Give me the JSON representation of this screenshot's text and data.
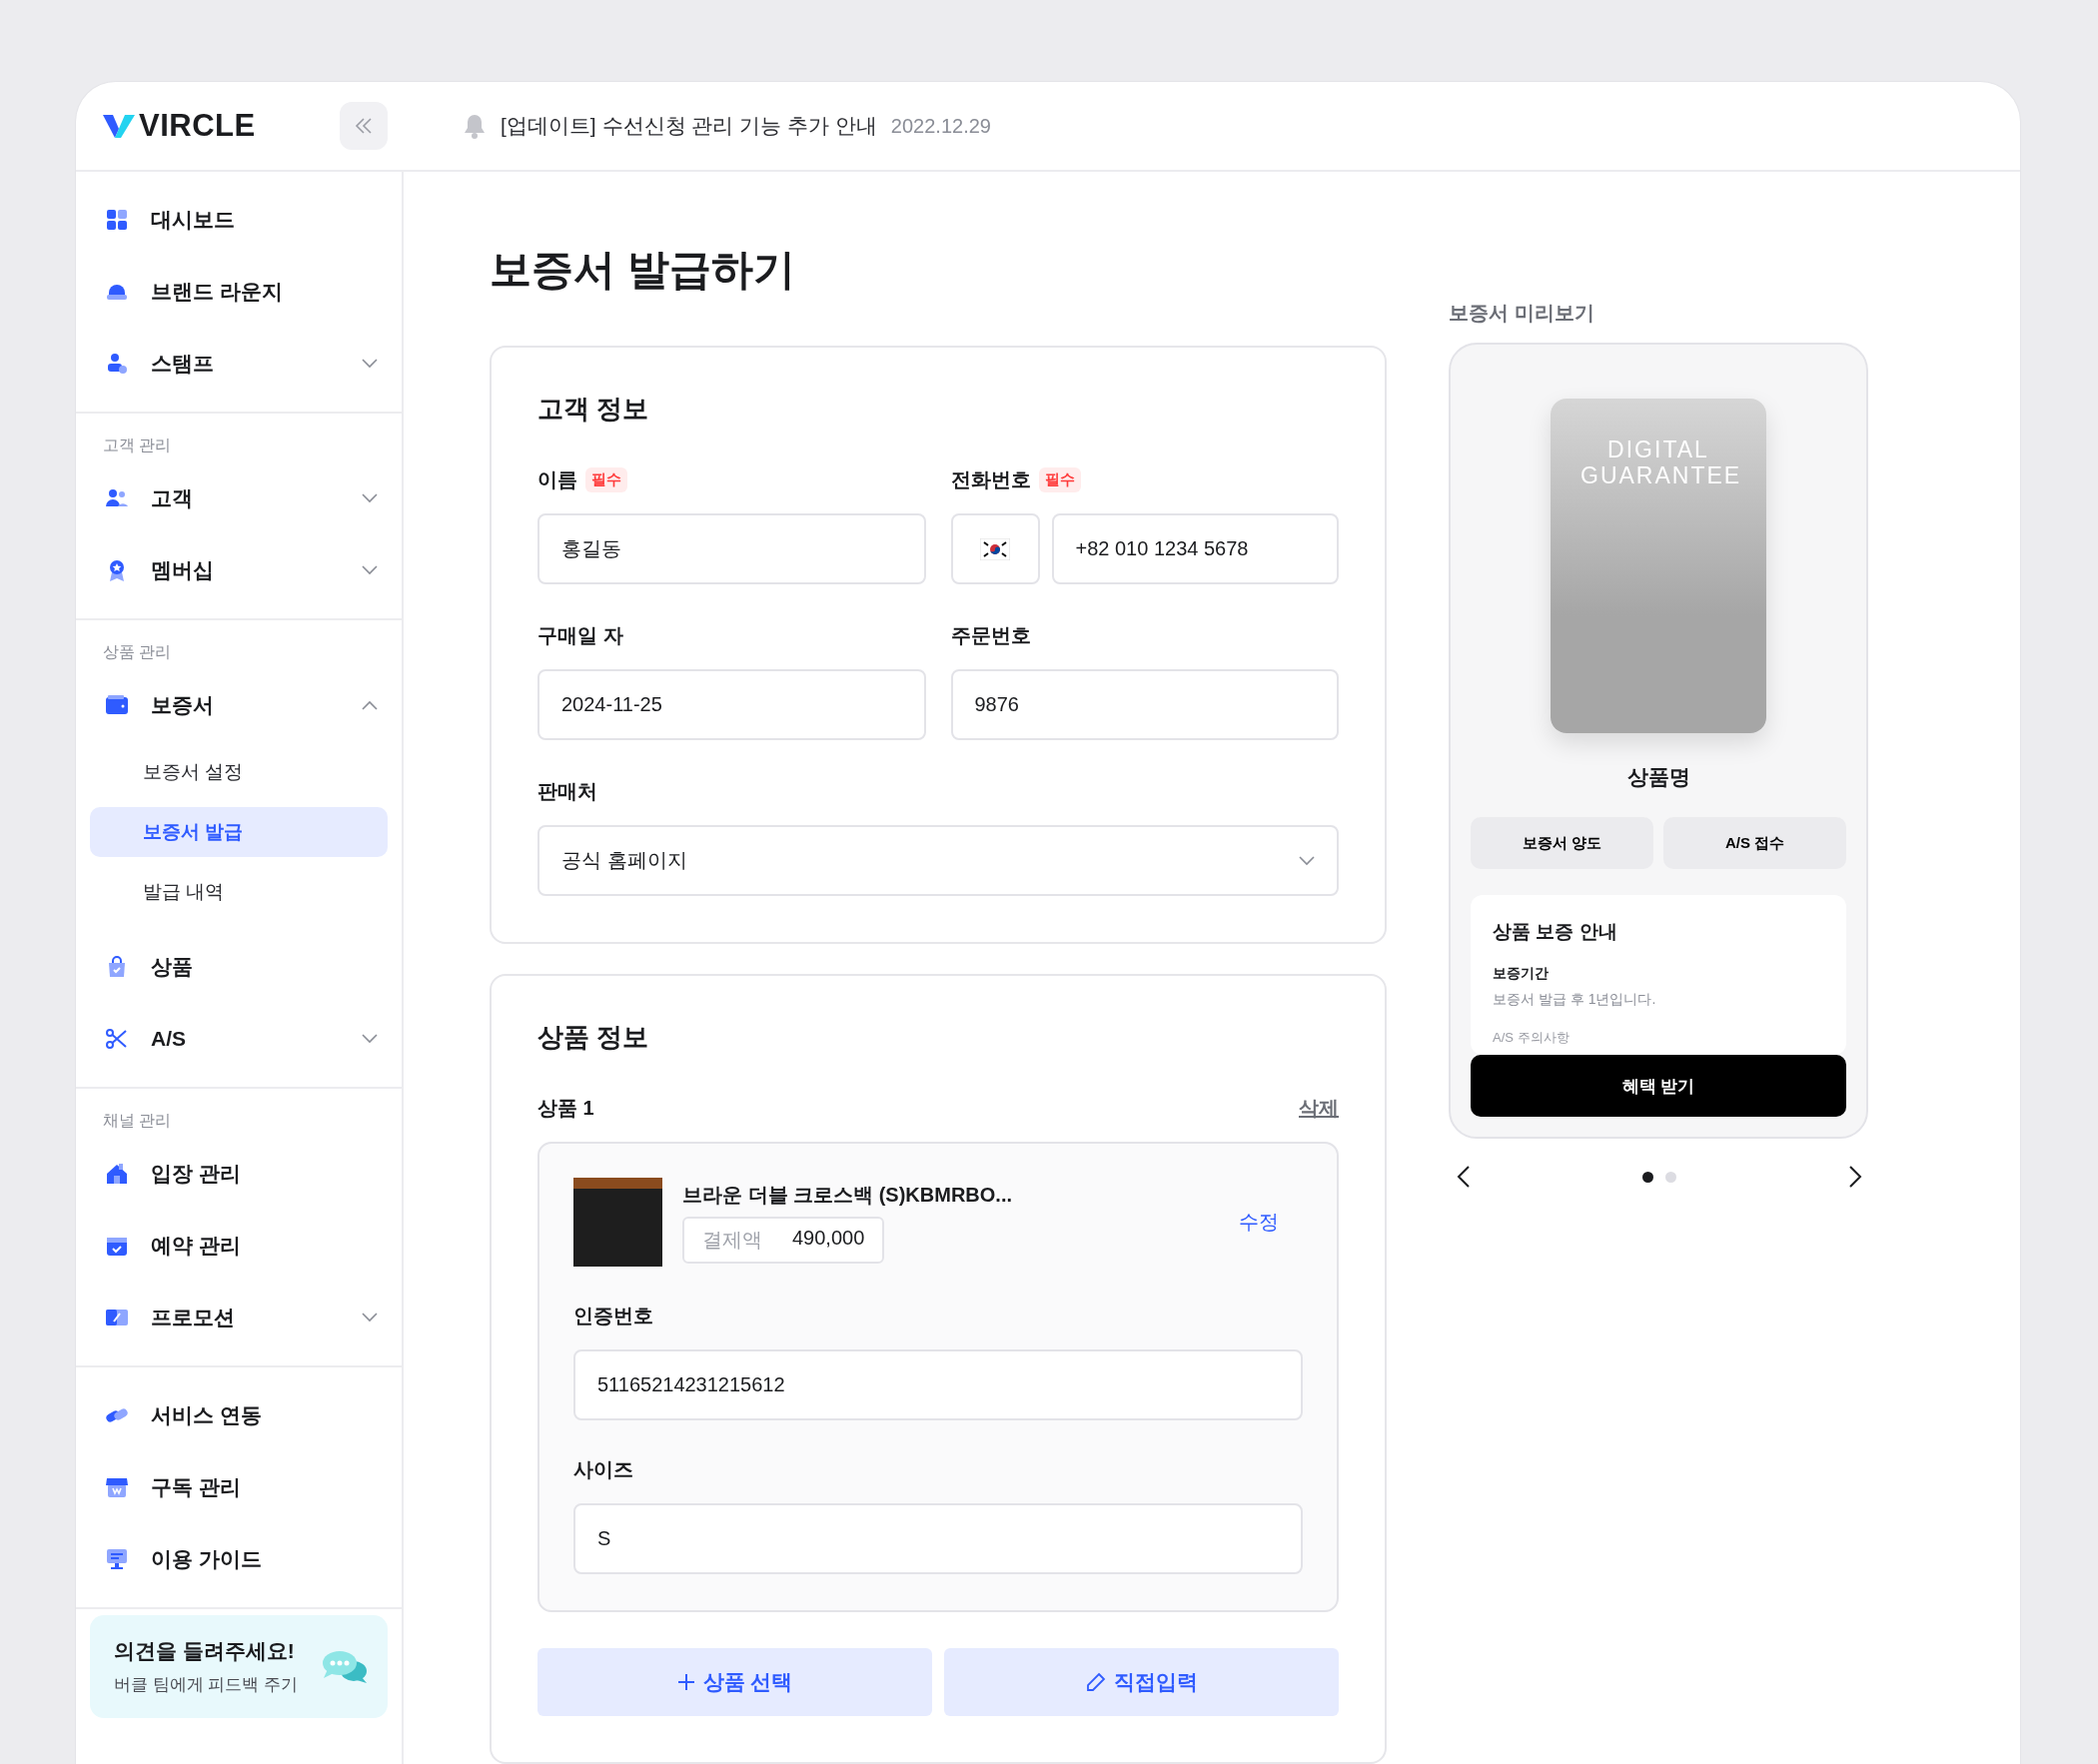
{
  "header": {
    "logo": "VIRCLE",
    "notice": "[업데이트] 수선신청 관리 기능 추가 안내",
    "notice_date": "2022.12.29"
  },
  "sidebar": {
    "sections": [
      {
        "items": [
          {
            "label": "대시보드"
          },
          {
            "label": "브랜드 라운지"
          },
          {
            "label": "스탬프",
            "expanded": false
          }
        ]
      },
      {
        "heading": "고객 관리",
        "items": [
          {
            "label": "고객",
            "expanded": false
          },
          {
            "label": "멤버십",
            "expanded": false
          }
        ]
      },
      {
        "heading": "상품 관리",
        "items": [
          {
            "label": "보증서",
            "expanded": true,
            "children": [
              {
                "label": "보증서 설정",
                "selected": false
              },
              {
                "label": "보증서 발급",
                "selected": true
              },
              {
                "label": "발급 내역",
                "selected": false
              }
            ]
          },
          {
            "label": "상품"
          },
          {
            "label": "A/S",
            "expanded": false
          }
        ]
      },
      {
        "heading": "채널 관리",
        "items": [
          {
            "label": "입장 관리"
          },
          {
            "label": "예약 관리"
          },
          {
            "label": "프로모션",
            "expanded": false
          }
        ]
      },
      {
        "items": [
          {
            "label": "서비스 연동"
          },
          {
            "label": "구독 관리"
          },
          {
            "label": "이용 가이드"
          }
        ]
      }
    ],
    "feedback": {
      "title": "의견을 들려주세요!",
      "subtitle": "버클 팀에게 피드백 주기"
    }
  },
  "page_title": "보증서 발급하기",
  "customer": {
    "title": "고객 정보",
    "fields": [
      {
        "label": "이름",
        "badge": "필수",
        "value": "홍길동"
      },
      {
        "label": "전화번호",
        "badge": "필수",
        "value": "+82 010 1234 5678",
        "kind": "phone"
      },
      {
        "label": "구매일 자",
        "value": "2024-11-25"
      },
      {
        "label": "주문번호",
        "value": "9876"
      },
      {
        "label": "판매처",
        "value": "공식 홈페이지",
        "kind": "select"
      }
    ]
  },
  "product_info": {
    "title": "상품 정보",
    "products": [
      {
        "heading": "상품 1",
        "delete": "삭제",
        "name": "브라운 더블 크로스백 (S)KBMRBO...",
        "price_label": "결제액",
        "price": "490,000",
        "edit": "수정",
        "fields": [
          {
            "label": "인증번호",
            "value": "51165214231215612"
          },
          {
            "label": "사이즈",
            "value": "S"
          }
        ]
      }
    ],
    "buttons": [
      {
        "label": "상품 선택",
        "kind": "add"
      },
      {
        "label": "직접입력",
        "kind": "edit"
      }
    ]
  },
  "preview": {
    "title": "보증서 미리보기",
    "card_text": "DIGITAL GUARANTEE",
    "product_name": "상품명",
    "actions": [
      "보증서 양도",
      "A/S 접수"
    ],
    "info_title": "상품 보증 안내",
    "info_items": [
      {
        "heading": "보증기간",
        "text": "보증서 발급 후 1년입니다."
      }
    ],
    "info_faded": "A/S 주의사항",
    "cta": "혜택 받기",
    "pages": [
      {
        "selected": true
      },
      {
        "selected": false
      }
    ]
  }
}
